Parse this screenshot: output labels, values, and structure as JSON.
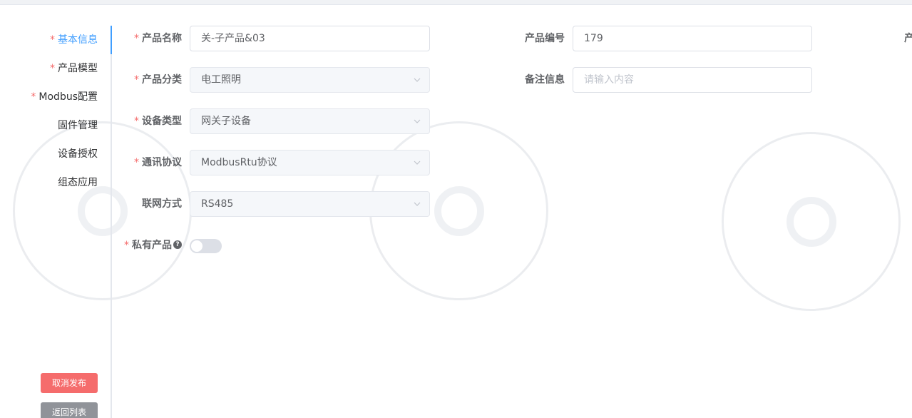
{
  "sidebar": {
    "tabs": [
      {
        "label": "基本信息",
        "required": true,
        "active": true
      },
      {
        "label": "产品模型",
        "required": true,
        "active": false
      },
      {
        "label": "Modbus配置",
        "required": true,
        "active": false
      },
      {
        "label": "固件管理",
        "required": false,
        "active": false
      },
      {
        "label": "设备授权",
        "required": false,
        "active": false
      },
      {
        "label": "组态应用",
        "required": false,
        "active": false
      }
    ],
    "required_mark": "*",
    "cancel_publish_label": "取消发布",
    "back_to_list_label": "返回列表"
  },
  "form": {
    "product_name": {
      "label": "产品名称",
      "value": "关-子产品&03"
    },
    "product_category": {
      "label": "产品分类",
      "value": "电工照明"
    },
    "device_type": {
      "label": "设备类型",
      "value": "网关子设备"
    },
    "protocol": {
      "label": "通讯协议",
      "value": "ModbusRtu协议"
    },
    "network_mode": {
      "label": "联网方式",
      "value": "RS485"
    },
    "private_product": {
      "label": "私有产品",
      "enabled": false,
      "help_icon": "?"
    },
    "product_code": {
      "label": "产品编号",
      "value": "179"
    },
    "remark": {
      "label": "备注信息",
      "placeholder": "请输入内容"
    },
    "cut_off_label": "产"
  },
  "colors": {
    "accent": "#409eff",
    "danger": "#f56c6c",
    "info": "#909399",
    "required": "#f56c6c"
  }
}
